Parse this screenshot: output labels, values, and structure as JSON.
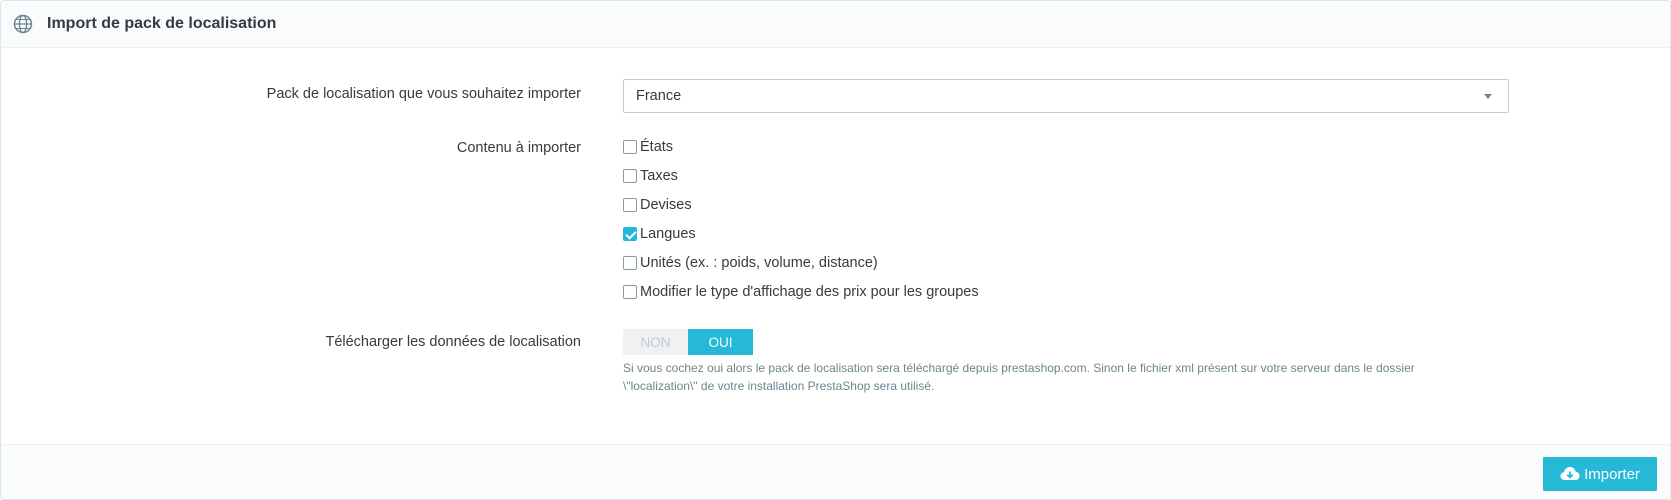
{
  "header": {
    "title": "Import de pack de localisation",
    "icon": "globe-icon"
  },
  "form": {
    "pack_label": "Pack de localisation que vous souhaitez importer",
    "pack_value": "France",
    "content_label": "Contenu à importer",
    "content_items": [
      {
        "label": "États",
        "checked": false
      },
      {
        "label": "Taxes",
        "checked": false
      },
      {
        "label": "Devises",
        "checked": false
      },
      {
        "label": "Langues",
        "checked": true
      },
      {
        "label": "Unités (ex. : poids, volume, distance)",
        "checked": false
      },
      {
        "label": "Modifier le type d'affichage des prix pour les groupes",
        "checked": false
      }
    ],
    "download_label": "Télécharger les données de localisation",
    "switch_off": "NON",
    "switch_on": "OUI",
    "switch_selected": "OUI",
    "help_line1": "Si vous cochez oui alors le pack de localisation sera téléchargé depuis prestashop.com. Sinon le fichier xml présent sur votre serveur dans le dossier",
    "help_line2": "\\\"localization\\\" de votre installation PrestaShop sera utilisé."
  },
  "footer": {
    "import_label": "Importer",
    "import_icon": "cloud-download-icon"
  },
  "colors": {
    "accent": "#25b9d7",
    "text": "#363a41",
    "muted": "#6c868e"
  }
}
